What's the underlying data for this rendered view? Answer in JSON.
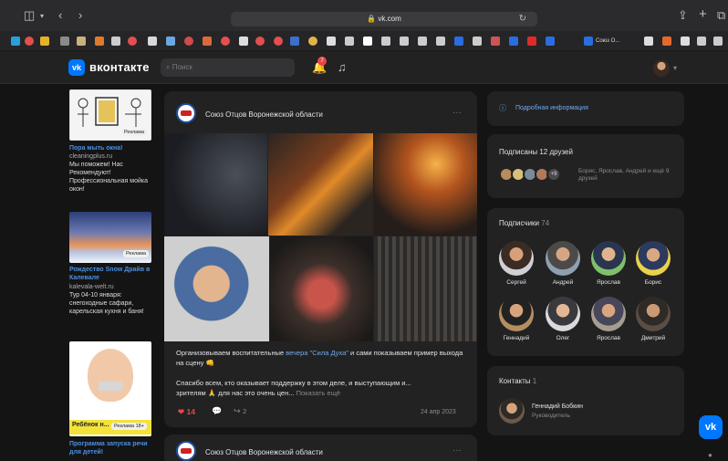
{
  "browser": {
    "url": "vk.com",
    "lock_icon": "lock-icon",
    "favorites_tab_label": "Союз О..."
  },
  "header": {
    "logo_text": "вконтакте",
    "search_placeholder": "Поиск",
    "notifications_count": "7"
  },
  "ads": [
    {
      "title": "Пора мыть окна!",
      "domain": "cleaningplus.ru",
      "description": "Мы поможем! Нас Рекомендуют! Профессиональная мойка окон!",
      "tag": "Реклама"
    },
    {
      "title": "Рождество Snow Драйв в Калевале",
      "domain": "kalevala-welt.ru",
      "description": "Тур 04-10 января: снегоходные сафари, карельская кухня и баня!",
      "tag": "Реклама"
    },
    {
      "title": "Программа запуска речи для детей!",
      "image_caption": "Ребёнок н...",
      "tag": "Реклама 18+"
    }
  ],
  "post": {
    "author": "Союз Отцов Воронежской области",
    "text_before_link": "Организовываем воспитательные ",
    "link_text": "вечера \"Сила Духа\"",
    "text_after_link": " и сами показываем пример выхода на сцену 👊",
    "text_line2": "Спасибо всем, кто оказывает поддержку в этом деле, и выступающим и...",
    "text_line3": "зрителям 🙏 для нас это очень цен...",
    "show_more": "Показать ещё",
    "likes": "14",
    "reposts": "2",
    "date": "24 апр 2023"
  },
  "next_post": {
    "author": "Союз Отцов Воронежской области"
  },
  "right": {
    "info_link": "Подробная информация",
    "friends_title": "Подписаны 12 друзей",
    "friends_more_badge": "+9",
    "friends_text": "Борис, Ярослав, Андрей и ещё 9 друзей",
    "subscribers_title": "Подписчики",
    "subscribers_count": "74",
    "subscribers": [
      {
        "name": "Сергей"
      },
      {
        "name": "Андрей"
      },
      {
        "name": "Ярослав"
      },
      {
        "name": "Борис"
      },
      {
        "name": "Геннадий"
      },
      {
        "name": "Олег"
      },
      {
        "name": "Ярослав"
      },
      {
        "name": "Дмитрий"
      }
    ],
    "contacts_title": "Контакты",
    "contacts_count": "1",
    "contact_name": "Геннадий Бобкин",
    "contact_role": "Руководитель"
  },
  "colors": {
    "accent": "#0077ff",
    "link": "#71aaeb",
    "like": "#e64646",
    "background": "#141414",
    "card": "#222223"
  }
}
